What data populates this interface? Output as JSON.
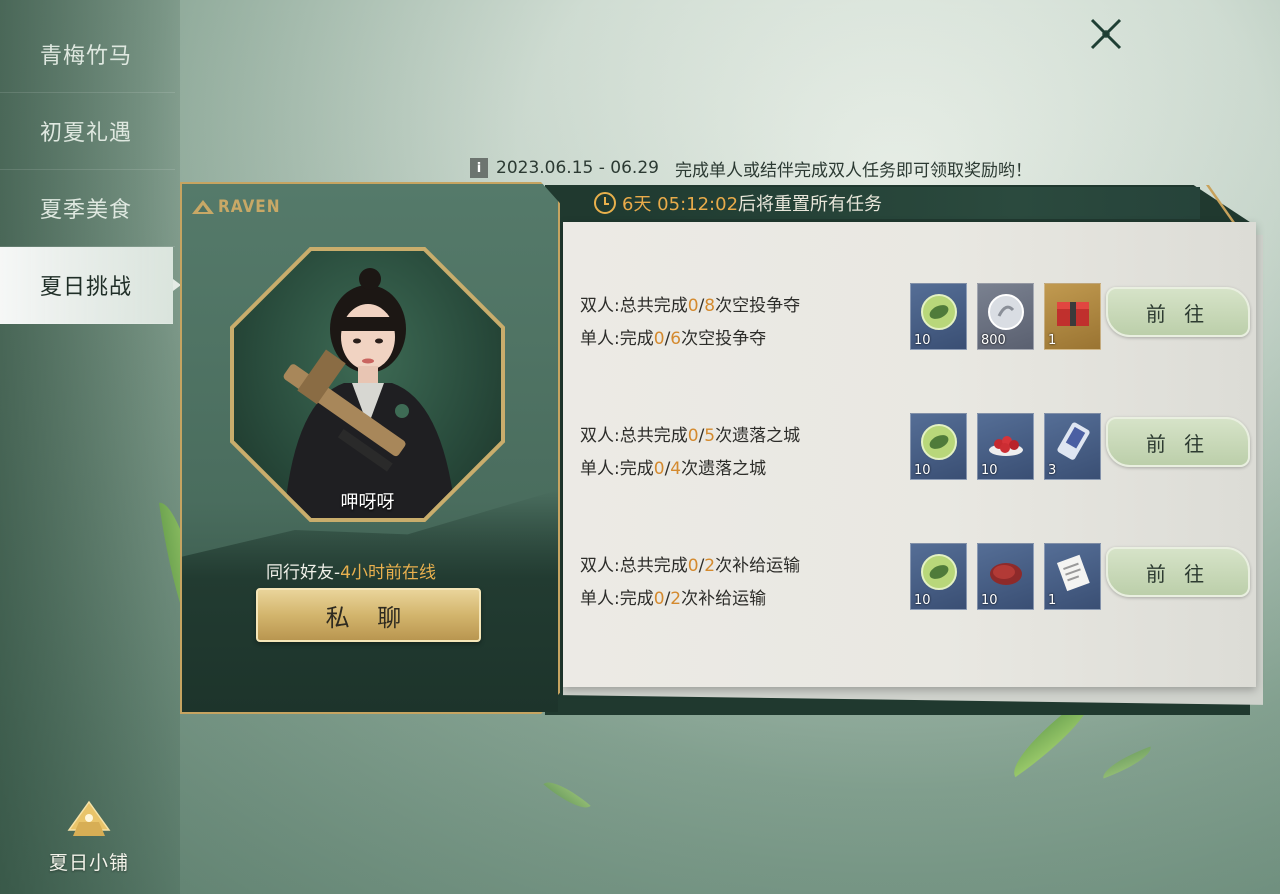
{
  "sidebar": {
    "items": [
      {
        "label": "青梅竹马"
      },
      {
        "label": "初夏礼遇"
      },
      {
        "label": "夏季美食"
      },
      {
        "label": "夏日挑战",
        "active": true
      }
    ],
    "shop_label": "夏日小铺"
  },
  "info": {
    "icon": "i",
    "date_range": "2023.06.15 - 06.29",
    "text": "完成单人或结伴完成双人任务即可领取奖励哟！"
  },
  "timer": {
    "time": "6天 05:12:02",
    "suffix": "后将重置所有任务"
  },
  "card": {
    "brand": "RAVEN",
    "character_name": "呷呀呀",
    "friend_prefix": "同行好友-",
    "friend_online": "4小时前在线",
    "chat_label": "私 聊"
  },
  "tasks": [
    {
      "duo_prefix": "双人:总共完成",
      "duo_done": "0",
      "duo_total": "8",
      "duo_suffix": "次空投争夺",
      "solo_prefix": "单人:完成",
      "solo_done": "0",
      "solo_total": "6",
      "solo_suffix": "次空投争夺",
      "rewards": [
        {
          "icon": "leaf-coin-icon",
          "qty": "10",
          "bg": "blue"
        },
        {
          "icon": "silver-coin-icon",
          "qty": "800",
          "bg": "gray"
        },
        {
          "icon": "supply-crate-icon",
          "qty": "1",
          "bg": "gold"
        }
      ],
      "button": "前 往"
    },
    {
      "duo_prefix": "双人:总共完成",
      "duo_done": "0",
      "duo_total": "5",
      "duo_suffix": "次遗落之城",
      "solo_prefix": "单人:完成",
      "solo_done": "0",
      "solo_total": "4",
      "solo_suffix": "次遗落之城",
      "rewards": [
        {
          "icon": "leaf-coin-icon",
          "qty": "10",
          "bg": "blue"
        },
        {
          "icon": "cherries-icon",
          "qty": "10",
          "bg": "blue"
        },
        {
          "icon": "ticket-card-icon",
          "qty": "3",
          "bg": "blue"
        }
      ],
      "button": "前 往"
    },
    {
      "duo_prefix": "双人:总共完成",
      "duo_done": "0",
      "duo_total": "2",
      "duo_suffix": "次补给运输",
      "solo_prefix": "单人:完成",
      "solo_done": "0",
      "solo_total": "2",
      "solo_suffix": "次补给运输",
      "rewards": [
        {
          "icon": "leaf-coin-icon",
          "qty": "10",
          "bg": "blue"
        },
        {
          "icon": "steak-icon",
          "qty": "10",
          "bg": "blue"
        },
        {
          "icon": "document-icon",
          "qty": "1",
          "bg": "blue"
        }
      ],
      "button": "前 往"
    }
  ],
  "colors": {
    "accent_orange": "#d48a2e",
    "gold": "#c6a461",
    "panel_green": "#20392f"
  }
}
